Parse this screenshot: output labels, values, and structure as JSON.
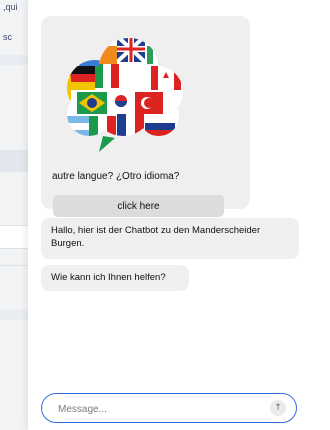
{
  "background_page": {
    "fragments": [
      ",qui",
      "sc"
    ]
  },
  "chat": {
    "language_card": {
      "image": "flag-cloud-icon",
      "prompt": "autre langue? ¿Otro idioma?",
      "button_label": "click here"
    },
    "messages": [
      {
        "from": "bot",
        "text": "Hallo, hier ist der Chatbot zu den Manderscheider Burgen."
      },
      {
        "from": "bot",
        "text": "Wie kann ich Ihnen helfen?"
      }
    ],
    "composer": {
      "placeholder": "Message...",
      "send_icon": "arrow-up-icon",
      "accent": "#2f6fe0"
    }
  }
}
